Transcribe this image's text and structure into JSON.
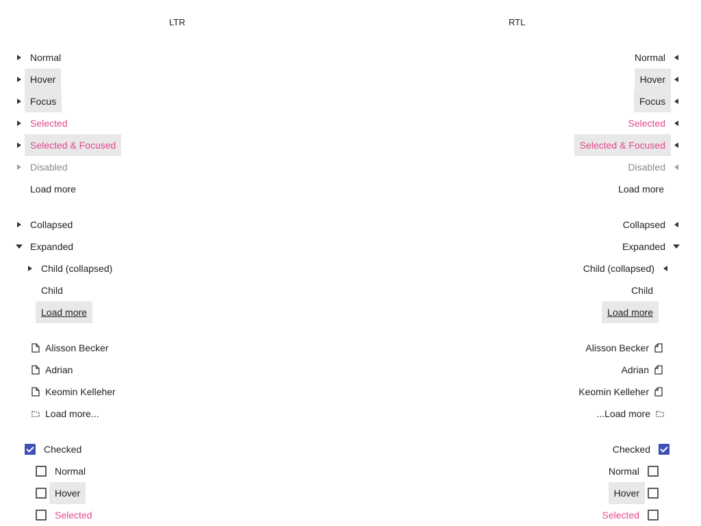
{
  "headers": {
    "ltr": "LTR",
    "rtl": "RTL"
  },
  "tree_states": {
    "normal": "Normal",
    "hover": "Hover",
    "focus": "Focus",
    "selected": "Selected",
    "selected_focused": "Selected & Focused",
    "disabled": "Disabled",
    "load_more": "Load more"
  },
  "nested": {
    "collapsed": "Collapsed",
    "expanded": "Expanded",
    "child_collapsed": "Child (collapsed)",
    "child": "Child",
    "load_more": "Load more"
  },
  "files": {
    "items": [
      "Alisson Becker",
      "Adrian",
      "Keomin Kelleher"
    ],
    "load_more_ltr": "Load more...",
    "load_more_rtl": "...Load more"
  },
  "checks": {
    "checked": "Checked",
    "normal": "Normal",
    "hover": "Hover",
    "selected": "Selected"
  },
  "colors": {
    "accent": "#e5478b",
    "checkbox": "#3f51b5",
    "highlight": "#e8e8e8"
  }
}
